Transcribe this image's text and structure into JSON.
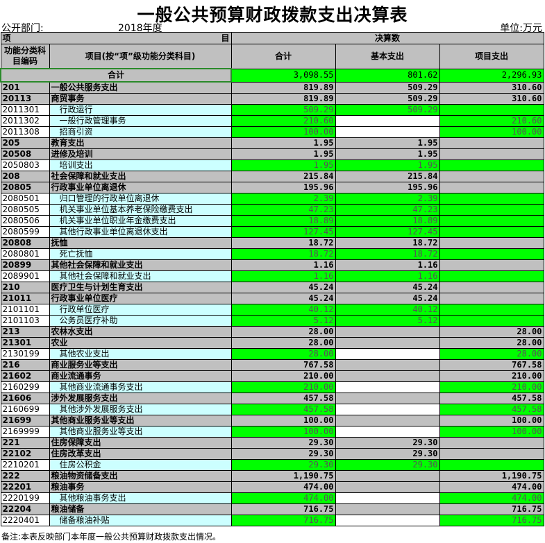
{
  "title": "一般公共预算财政拨款支出决算表",
  "unit_left": "公开部门:",
  "year": "2018年度",
  "unit_right": "单位:万元",
  "header": {
    "item": "项",
    "item_end": "目",
    "decision": "决算数",
    "code_col": "功能分类科目编码",
    "name_col": "项目(按“项”级功能分类科目)",
    "total_col": "合计",
    "basic_col": "基本支出",
    "project_col": "项目支出"
  },
  "total_row": {
    "label": "合计",
    "total": "3,098.55",
    "basic": "801.62",
    "project": "2,296.93"
  },
  "rows": [
    {
      "level": 1,
      "code": "201",
      "name": "一般公共服务支出",
      "total": "819.89",
      "basic": "509.29",
      "project": "310.60"
    },
    {
      "level": 2,
      "code": "20113",
      "name": "商贸事务",
      "total": "819.89",
      "basic": "509.29",
      "project": "310.60"
    },
    {
      "level": 3,
      "code": "2011301",
      "name": "行政运行",
      "total": "509.29",
      "basic": "509.29",
      "project": ""
    },
    {
      "level": 3,
      "code": "2011302",
      "name": "一般行政管理事务",
      "total": "210.60",
      "basic": "",
      "project": "210.60"
    },
    {
      "level": 3,
      "code": "2011308",
      "name": "招商引资",
      "total": "100.00",
      "basic": "",
      "project": "100.00"
    },
    {
      "level": 1,
      "code": "205",
      "name": "教育支出",
      "total": "1.95",
      "basic": "1.95",
      "project": ""
    },
    {
      "level": 2,
      "code": "20508",
      "name": "进修及培训",
      "total": "1.95",
      "basic": "1.95",
      "project": ""
    },
    {
      "level": 3,
      "code": "2050803",
      "name": "培训支出",
      "total": "1.95",
      "basic": "1.95",
      "project": ""
    },
    {
      "level": 1,
      "code": "208",
      "name": "社会保障和就业支出",
      "total": "215.84",
      "basic": "215.84",
      "project": ""
    },
    {
      "level": 2,
      "code": "20805",
      "name": "行政事业单位离退休",
      "total": "195.96",
      "basic": "195.96",
      "project": ""
    },
    {
      "level": 3,
      "code": "2080501",
      "name": "归口管理的行政单位离退休",
      "total": "2.39",
      "basic": "2.39",
      "project": ""
    },
    {
      "level": 3,
      "code": "2080505",
      "name": "机关事业单位基本养老保险缴费支出",
      "total": "47.23",
      "basic": "47.23",
      "project": ""
    },
    {
      "level": 3,
      "code": "2080506",
      "name": "机关事业单位职业年金缴费支出",
      "total": "18.89",
      "basic": "18.89",
      "project": ""
    },
    {
      "level": 3,
      "code": "2080599",
      "name": "其他行政事业单位离退休支出",
      "total": "127.45",
      "basic": "127.45",
      "project": ""
    },
    {
      "level": 2,
      "code": "20808",
      "name": "抚恤",
      "total": "18.72",
      "basic": "18.72",
      "project": ""
    },
    {
      "level": 3,
      "code": "2080801",
      "name": "死亡抚恤",
      "total": "18.72",
      "basic": "18.72",
      "project": ""
    },
    {
      "level": 2,
      "code": "20899",
      "name": "其他社会保障和就业支出",
      "total": "1.16",
      "basic": "1.16",
      "project": ""
    },
    {
      "level": 3,
      "code": "2089901",
      "name": "其他社会保障和就业支出",
      "total": "1.16",
      "basic": "1.16",
      "project": ""
    },
    {
      "level": 1,
      "code": "210",
      "name": "医疗卫生与计划生育支出",
      "total": "45.24",
      "basic": "45.24",
      "project": ""
    },
    {
      "level": 2,
      "code": "21011",
      "name": "行政事业单位医疗",
      "total": "45.24",
      "basic": "45.24",
      "project": ""
    },
    {
      "level": 3,
      "code": "2101101",
      "name": "行政单位医疗",
      "total": "40.12",
      "basic": "40.12",
      "project": ""
    },
    {
      "level": 3,
      "code": "2101103",
      "name": "公务员医疗补助",
      "total": "5.12",
      "basic": "5.12",
      "project": ""
    },
    {
      "level": 1,
      "code": "213",
      "name": "农林水支出",
      "total": "28.00",
      "basic": "",
      "project": "28.00"
    },
    {
      "level": 2,
      "code": "21301",
      "name": "农业",
      "total": "28.00",
      "basic": "",
      "project": "28.00"
    },
    {
      "level": 3,
      "code": "2130199",
      "name": "其他农业支出",
      "total": "28.00",
      "basic": "",
      "project": "28.00"
    },
    {
      "level": 1,
      "code": "216",
      "name": "商业服务业等支出",
      "total": "767.58",
      "basic": "",
      "project": "767.58"
    },
    {
      "level": 2,
      "code": "21602",
      "name": "商业流通事务",
      "total": "210.00",
      "basic": "",
      "project": "210.00"
    },
    {
      "level": 3,
      "code": "2160299",
      "name": "其他商业流通事务支出",
      "total": "210.00",
      "basic": "",
      "project": "210.00"
    },
    {
      "level": 2,
      "code": "21606",
      "name": "涉外发展服务支出",
      "total": "457.58",
      "basic": "",
      "project": "457.58"
    },
    {
      "level": 3,
      "code": "2160699",
      "name": "其他涉外发展服务支出",
      "total": "457.58",
      "basic": "",
      "project": "457.58"
    },
    {
      "level": 2,
      "code": "21699",
      "name": "其他商业服务业等支出",
      "total": "100.00",
      "basic": "",
      "project": "100.00"
    },
    {
      "level": 3,
      "code": "2169999",
      "name": "其他商业服务业等支出",
      "total": "100.00",
      "basic": "",
      "project": "100.00"
    },
    {
      "level": 1,
      "code": "221",
      "name": "住房保障支出",
      "total": "29.30",
      "basic": "29.30",
      "project": ""
    },
    {
      "level": 2,
      "code": "22102",
      "name": "住房改革支出",
      "total": "29.30",
      "basic": "29.30",
      "project": ""
    },
    {
      "level": 3,
      "code": "2210201",
      "name": "住房公积金",
      "total": "29.30",
      "basic": "29.30",
      "project": ""
    },
    {
      "level": 1,
      "code": "222",
      "name": "粮油物资储备支出",
      "total": "1,190.75",
      "basic": "",
      "project": "1,190.75"
    },
    {
      "level": 2,
      "code": "22201",
      "name": "粮油事务",
      "total": "474.00",
      "basic": "",
      "project": "474.00"
    },
    {
      "level": 3,
      "code": "2220199",
      "name": "其他粮油事务支出",
      "total": "474.00",
      "basic": "",
      "project": "474.00"
    },
    {
      "level": 2,
      "code": "22204",
      "name": "粮油储备",
      "total": "716.75",
      "basic": "",
      "project": "716.75"
    },
    {
      "level": 3,
      "code": "2220401",
      "name": "储备粮油补贴",
      "total": "716.75",
      "basic": "",
      "project": "716.75"
    }
  ],
  "note": "备注:本表反映部门本年度一般公共预算财政拨款支出情况。"
}
